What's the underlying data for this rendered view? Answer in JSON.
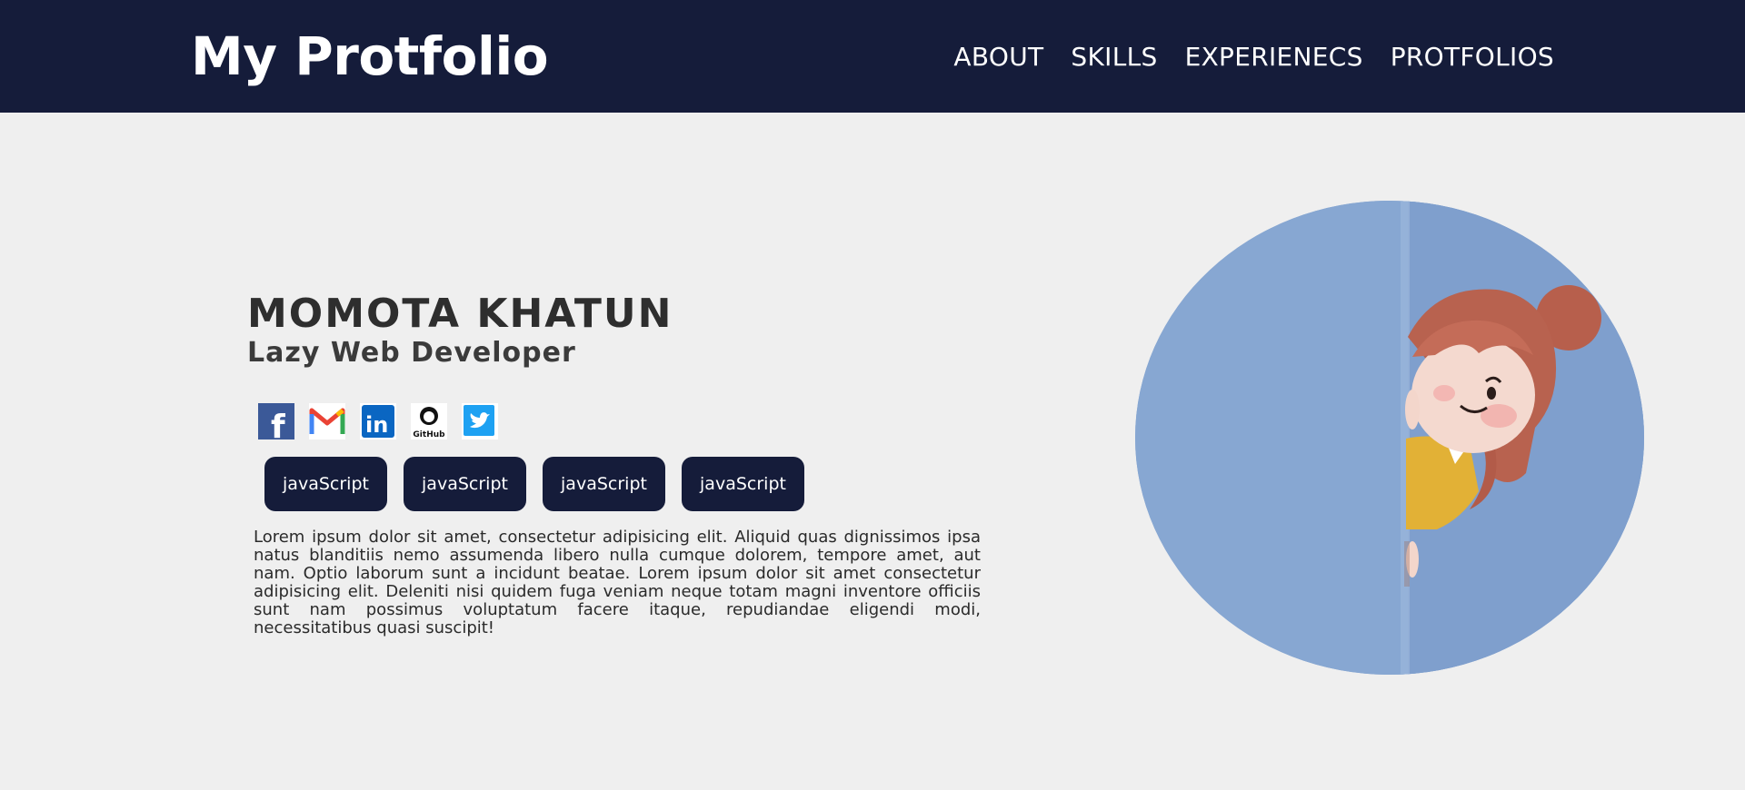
{
  "header": {
    "brand": "My Protfolio",
    "nav": [
      "ABOUT",
      "SKILLS",
      "EXPERIENECS",
      "PROTFOLIOS"
    ]
  },
  "profile": {
    "name": "MOMOTA KHATUN",
    "role": "Lazy Web Developer",
    "socials": [
      {
        "icon": "facebook-icon",
        "label": "f"
      },
      {
        "icon": "gmail-icon",
        "label": "M"
      },
      {
        "icon": "linkedin-icon",
        "label": "in"
      },
      {
        "icon": "github-icon",
        "label": "GitHub"
      },
      {
        "icon": "twitter-icon",
        "label": ""
      }
    ],
    "skills": [
      "javaScript",
      "javaScript",
      "javaScript",
      "javaScript"
    ],
    "bio": "Lorem ipsum dolor sit amet, consectetur adipisicing elit. Aliquid quas dignissimos ipsa natus blanditiis nemo assumenda libero nulla cumque dolorem, tempore amet, aut nam. Optio laborum sunt a incidunt beatae. Lorem ipsum dolor sit amet consectetur adipisicing elit. Deleniti nisi quidem fuga veniam neque totam magni inventore officiis sunt nam possimus voluptatum facere itaque, repudiandae eligendi modi, necessitatibus quasi suscipit!"
  },
  "colors": {
    "header_bg": "#151c3a",
    "page_bg": "#efefef",
    "chip_bg": "#151c3a",
    "hero_bg": "#86a6d1"
  }
}
